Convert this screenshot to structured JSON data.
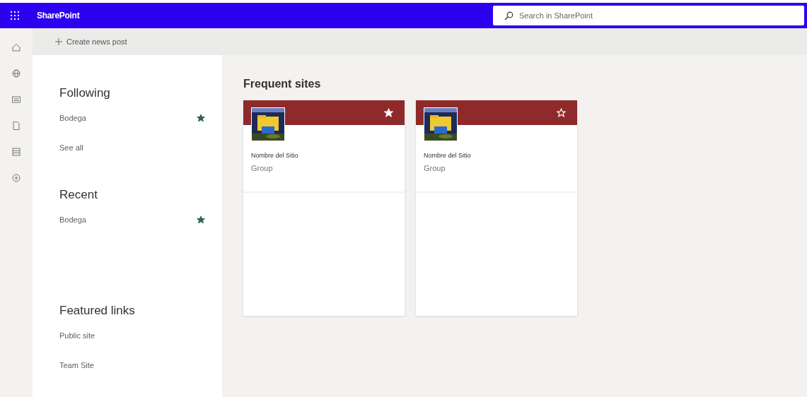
{
  "app_bar": {
    "title": "SharePoint",
    "search": {
      "placeholder": "Search in SharePoint"
    }
  },
  "command_bar": {
    "create_button": "Create news post"
  },
  "left_panel": {
    "sections": [
      {
        "heading": "Following",
        "items": [
          {
            "label": "Bodega",
            "kind": "site",
            "followed": true
          },
          {
            "label": "See all",
            "kind": "link"
          }
        ]
      },
      {
        "heading": "Recent",
        "items": [
          {
            "label": "Bodega",
            "kind": "site",
            "followed": true
          }
        ]
      },
      {
        "heading": "Featured links",
        "items": [
          {
            "label": "Public site",
            "kind": "link"
          },
          {
            "label": "Team Site",
            "kind": "link"
          }
        ]
      }
    ]
  },
  "frequent_sites": {
    "heading": "Frequent sites",
    "cards": [
      {
        "name": "Nombre del Sitio",
        "type": "Group",
        "followed": true,
        "color": "#8e2a2a"
      },
      {
        "name": "Nombre del Sitio",
        "type": "Group",
        "followed": false,
        "color": "#8e2a2a"
      }
    ]
  }
}
